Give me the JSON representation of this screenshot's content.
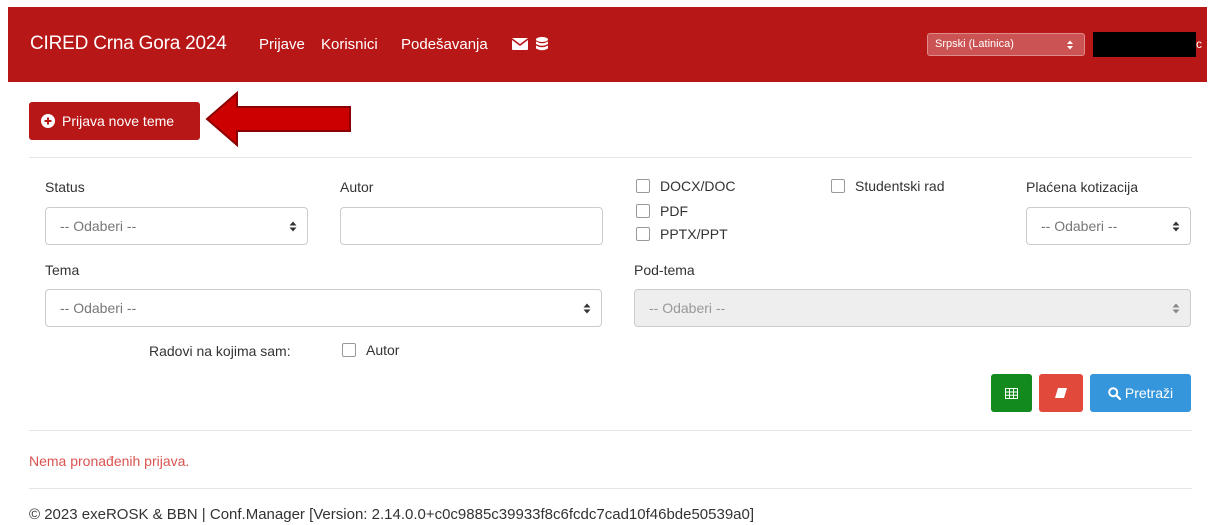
{
  "navbar": {
    "brand": "CIRED Crna Gora 2024",
    "links": [
      "Prijave",
      "Korisnici",
      "Podešavanja"
    ],
    "icons": [
      "envelope-icon",
      "database-icon"
    ],
    "language": "Srpski (Latinica)",
    "user_tail": "c"
  },
  "actions": {
    "new_topic": "Prijava nove teme"
  },
  "filters": {
    "status": {
      "label": "Status",
      "value": "-- Odaberi --"
    },
    "author": {
      "label": "Autor",
      "value": ""
    },
    "file_types": [
      "DOCX/DOC",
      "PDF",
      "PPTX/PPT"
    ],
    "student_work": "Studentski rad",
    "fee_paid": {
      "label": "Plaćena kotizacija",
      "value": "-- Odaberi --"
    },
    "topic": {
      "label": "Tema",
      "value": "-- Odaberi --"
    },
    "subtopic": {
      "label": "Pod-tema",
      "value": "-- Odaberi --"
    },
    "my_papers": {
      "label": "Radovi na kojima sam:",
      "option": "Autor"
    }
  },
  "buttons": {
    "search": "Pretraži"
  },
  "results": {
    "empty": "Nema pronađenih prijava."
  },
  "footer": {
    "text": "© 2023 exeROSK & BBN | Conf.Manager [Version: 2.14.0.0+c0c9885c39933f8c6fcdc7cad10f46bde50539a0]"
  },
  "colors": {
    "brand": "#b81717",
    "excel": "#138a1d",
    "clear": "#e14a3b",
    "search": "#3596db",
    "error_text": "#d9534f"
  }
}
